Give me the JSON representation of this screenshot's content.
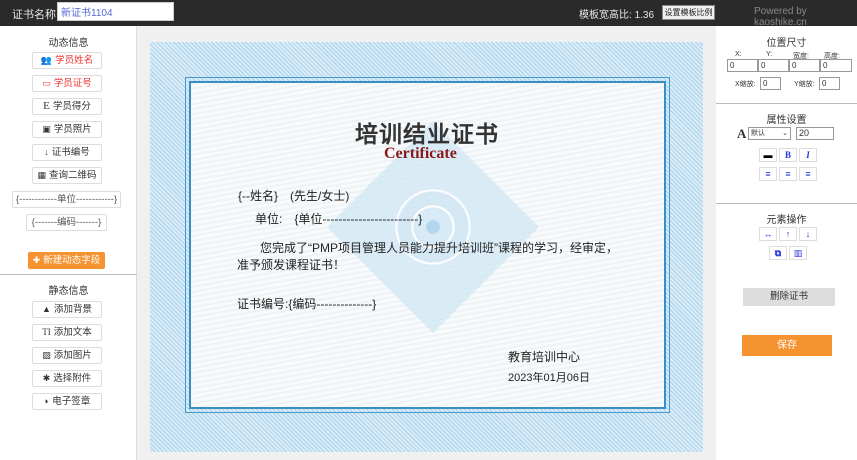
{
  "topbar": {
    "name_label": "证书名称:",
    "name_value": "新证书1104",
    "ratio_label": "模板宽高比:",
    "ratio_value": "1.36",
    "set_ratio_button": "设置模板比例",
    "powered": "Powered by kaoshike.cn"
  },
  "left": {
    "dynamic_title": "动态信息",
    "dynamic_items": [
      "学员姓名",
      "学员证号",
      "学员得分",
      "学员照片",
      "证书编号",
      "查询二维码"
    ],
    "unit_field": "{------------单位------------}",
    "code_field": "{-------编码-------}",
    "new_field_button": "新建动态字段",
    "static_title": "静态信息",
    "static_items": [
      "添加背景",
      "添加文本",
      "添加图片",
      "选择附件",
      "电子签章"
    ]
  },
  "right": {
    "position_title": "位置尺寸",
    "x_label": "X:",
    "y_label": "Y:",
    "w_label": "宽度:",
    "h_label": "高度:",
    "x": "0",
    "y": "0",
    "w": "0",
    "h": "0",
    "xscale_label": "X缩放:",
    "xscale": "0",
    "yscale_label": "Y缩放:",
    "yscale": "0",
    "attr_title": "属性设置",
    "font_select": "默认",
    "font_size": "20",
    "ops_title": "元素操作",
    "delete_button": "删除证书",
    "save_button": "保存"
  },
  "certificate": {
    "title": "培训结业证书",
    "subtitle": "Certificate",
    "name_line": "{--姓名}　(先生/女士)",
    "unit_label": "单位:",
    "unit_value": "{单位------------------------}",
    "body_line1": "您完成了“PMP项目管理人员能力提升培训班”课程的学习，经审定，",
    "body_line2": "准予颁发课程证书！",
    "code_label": "证书编号:",
    "code_value": "{编码--------------}",
    "issuer": "教育培训中心",
    "date": "2023年01月06日"
  }
}
